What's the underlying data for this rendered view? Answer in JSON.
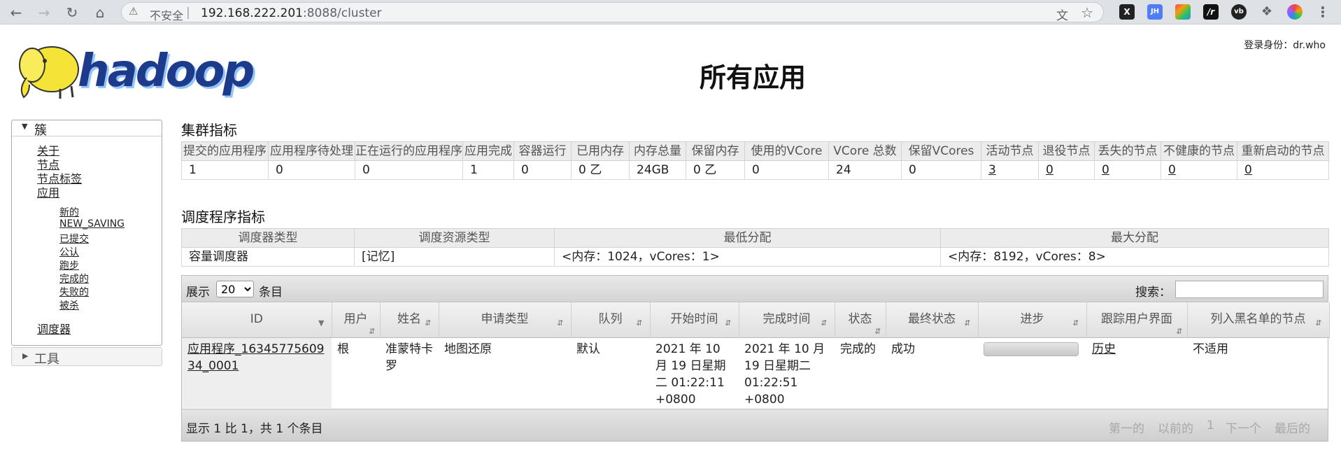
{
  "browser": {
    "insecure_label": "不安全",
    "url_host": "192.168.222.201",
    "url_rest": ":8088/cluster",
    "ext_icons": [
      "x-extension-icon",
      "jh-extension-icon",
      "palette-extension-icon",
      "r-extension-icon",
      "vb-extension-icon",
      "puzzle-extension-icon",
      "profile-avatar-icon",
      "menu-dots-icon"
    ]
  },
  "header": {
    "logo_text": "hadoop",
    "title": "所有应用",
    "login": "登录身份：dr.who"
  },
  "sidebar": {
    "cluster_label": "簇",
    "items": [
      "关于",
      "节点",
      "节点标签",
      "应用"
    ],
    "app_states": [
      "新的",
      "NEW_SAVING",
      "已提交",
      "公认",
      "跑步",
      "完成的",
      "失败的",
      "被杀"
    ],
    "scheduler": "调度器",
    "tools_label": "工具"
  },
  "cluster_metrics": {
    "title": "集群指标",
    "headers": [
      "提交的应用程序",
      "应用程序待处理",
      "正在运行的应用程序",
      "应用完成",
      "容器运行",
      "已用内存",
      "内存总量",
      "保留内存",
      "使用的VCore",
      "VCore 总数",
      "保留VCores",
      "活动节点",
      "退役节点",
      "丢失的节点",
      "不健康的节点",
      "重新启动的节点"
    ],
    "values": [
      "1",
      "0",
      "0",
      "1",
      "0",
      "0 乙",
      "24GB",
      "0 乙",
      "0",
      "24",
      "0",
      "3",
      "0",
      "0",
      "0",
      "0"
    ]
  },
  "scheduler_metrics": {
    "title": "调度程序指标",
    "headers": [
      "调度器类型",
      "调度资源类型",
      "最低分配",
      "最大分配"
    ],
    "values": [
      "容量调度器",
      "[记忆]",
      "<内存：1024，vCores：1>",
      "<内存：8192，vCores：8>"
    ]
  },
  "apps": {
    "show_label": "展示",
    "page_size": "20",
    "entries_label": "条目",
    "search_label": "搜索：",
    "headers": [
      "ID",
      "用户",
      "姓名",
      "申请类型",
      "队列",
      "开始时间",
      "完成时间",
      "状态",
      "最终状态",
      "进步",
      "跟踪用户界面",
      "列入黑名单的节点"
    ],
    "rows": [
      {
        "id": "应用程序_1634577560934_0001",
        "user": "根",
        "name": "准蒙特卡罗",
        "type": "地图还原",
        "queue": "默认",
        "start": "2021 年 10 月 19 日星期二 01:22:11 +0800",
        "finish": "2021 年 10 月 19 日星期二 01:22:51 +0800",
        "state": "完成的",
        "final_status": "成功",
        "progress": 1.0,
        "tracking_ui": "历史",
        "blacklisted": "不适用"
      }
    ],
    "footer_info": "显示 1 比 1，共 1 个条目",
    "pager": {
      "first": "第一的",
      "prev": "以前的",
      "page": "1",
      "next": "下一个",
      "last": "最后的"
    }
  }
}
